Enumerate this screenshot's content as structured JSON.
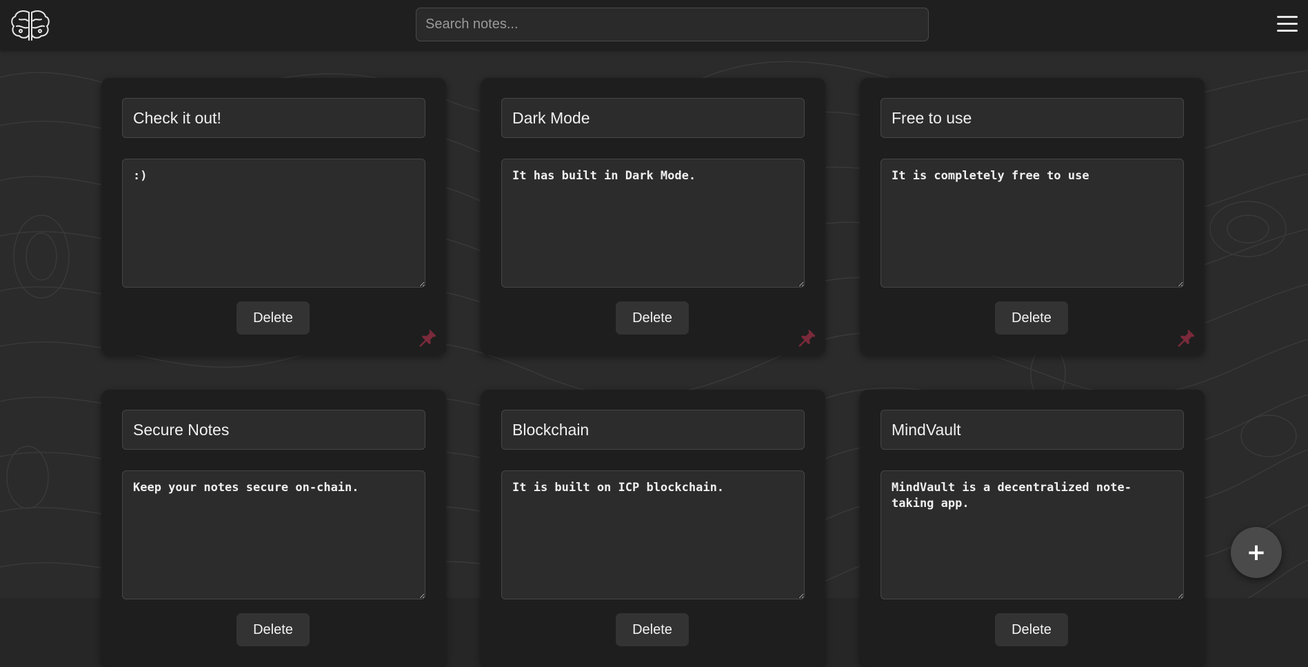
{
  "search": {
    "placeholder": "Search notes...",
    "value": ""
  },
  "notes": [
    {
      "title": "Check it out!",
      "content": ":)",
      "delete_label": "Delete"
    },
    {
      "title": "Dark Mode",
      "content": "It has built in Dark Mode.",
      "delete_label": "Delete"
    },
    {
      "title": "Free to use",
      "content": "It is completely free to use",
      "delete_label": "Delete"
    },
    {
      "title": "Secure Notes",
      "content": "Keep your notes secure on-chain.",
      "delete_label": "Delete"
    },
    {
      "title": "Blockchain",
      "content": "It is built on ICP blockchain.",
      "delete_label": "Delete"
    },
    {
      "title": "MindVault",
      "content": "MindVault is a decentralized note-taking app.",
      "delete_label": "Delete"
    }
  ],
  "fab": {
    "label": "+"
  },
  "icons": {
    "logo": "brain-logo-icon",
    "menu": "hamburger-menu-icon",
    "pin": "pin-icon",
    "add": "plus-icon"
  },
  "colors": {
    "header_bg": "#1f1f1f",
    "card_bg": "#1e1e1e",
    "field_bg": "#2c2c2c",
    "pin": "#7a2a3a",
    "fab_bg": "#4a4a4a"
  }
}
